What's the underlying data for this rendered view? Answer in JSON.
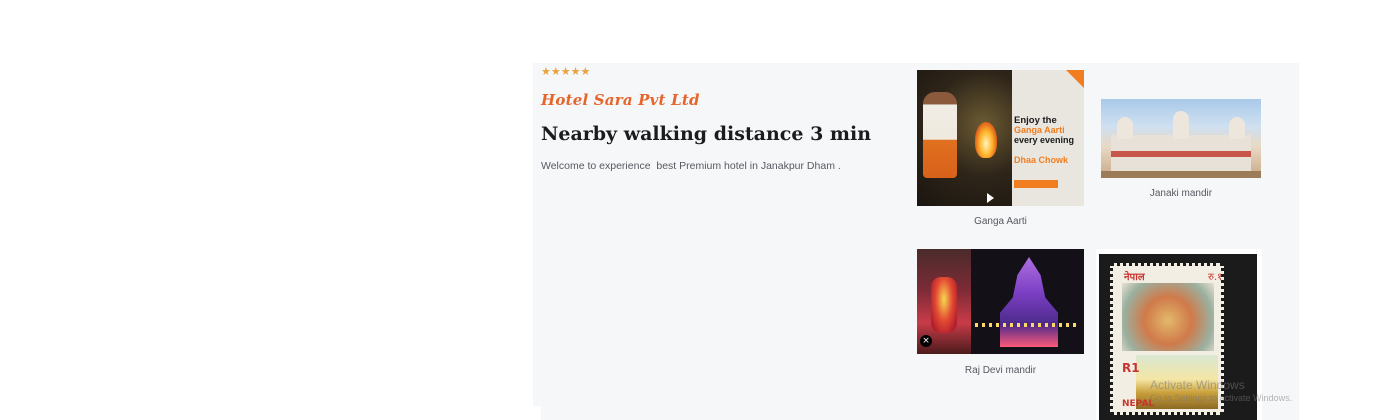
{
  "rating": {
    "stars": 5,
    "color": "#e9a23b"
  },
  "brand": "Hotel Sara Pvt Ltd",
  "headline": "Nearby walking distance 3 min",
  "description": "Welcome to experience  best Premium hotel in Janakpur Dham .",
  "colors": {
    "accent": "#e5652b",
    "panel_bg": "#f6f7f9",
    "text": "#1c1c1c",
    "muted": "#555a60"
  },
  "gallery": [
    {
      "caption": "Ganga Aarti",
      "image": {
        "line1": "Enjoy the",
        "line2": "Ganga Aarti",
        "line3": "every evening",
        "line4": "Dhaa Chowk"
      }
    },
    {
      "caption": "Janaki mandir"
    },
    {
      "caption": "Raj Devi mandir"
    },
    {
      "caption": "",
      "image": {
        "title": "नेपाल",
        "value": "रु.१",
        "denomination": "R1",
        "country": "NEPAL"
      }
    }
  ],
  "watermark": {
    "line1": "Activate Windows",
    "line2": "Go to Settings to activate Windows."
  }
}
